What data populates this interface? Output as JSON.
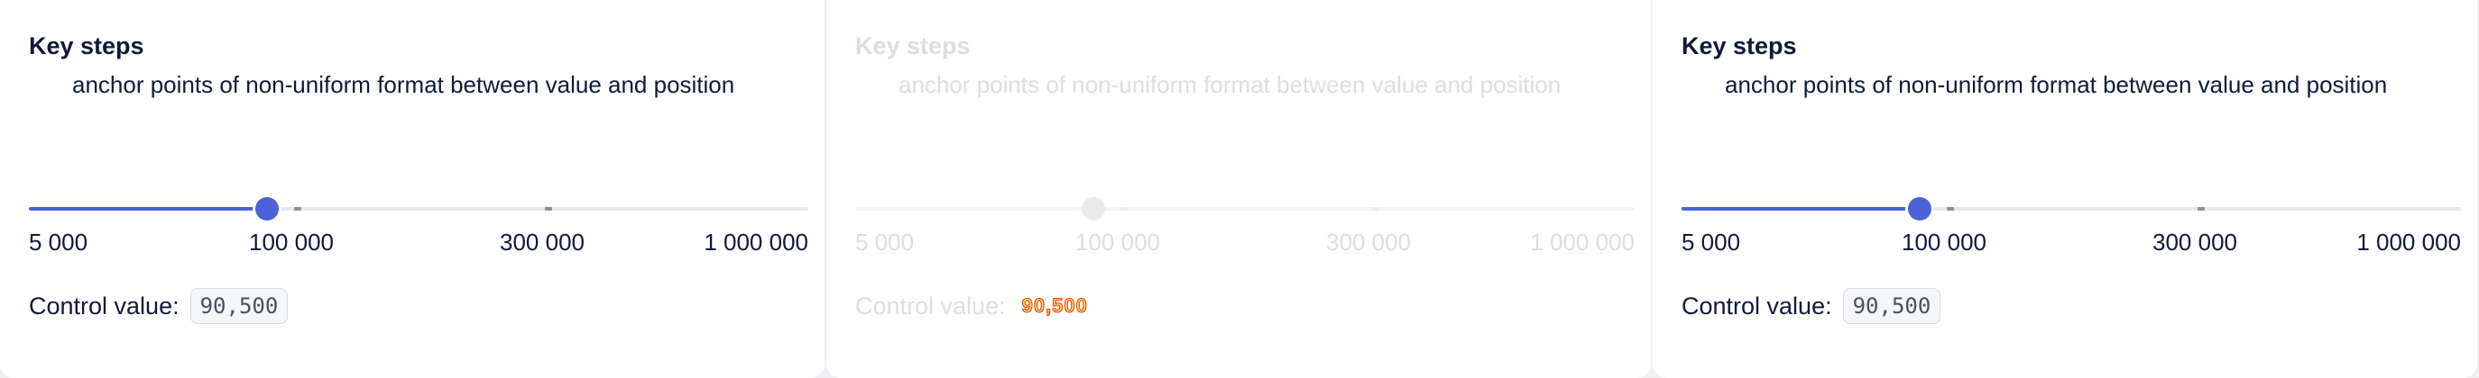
{
  "panels": [
    {
      "title": "Key steps",
      "description": "anchor points of non-uniform format between value and position",
      "slider": {
        "state": "enabled",
        "value_position_fraction": 0.305,
        "marks": [
          "5 000",
          "100 000",
          "300 000",
          "1 000 000"
        ]
      },
      "control_label": "Control value:",
      "control_value": "90,500"
    },
    {
      "title": "Key steps",
      "description": "anchor points of non-uniform format between value and position",
      "slider": {
        "state": "disabled",
        "value_position_fraction": 0.305,
        "marks": [
          "5 000",
          "100 000",
          "300 000",
          "1 000 000"
        ]
      },
      "control_label": "Control value:",
      "control_value": "90,500"
    },
    {
      "title": "Key steps",
      "description": "anchor points of non-uniform format between value and position",
      "slider": {
        "state": "enabled",
        "value_position_fraction": 0.305,
        "marks": [
          "5 000",
          "100 000",
          "300 000",
          "1 000 000"
        ]
      },
      "control_label": "Control value:",
      "control_value": "90,500"
    }
  ],
  "colors": {
    "accent": "#4b63d6",
    "text": "#0f1a3a",
    "rail": "#e7e9ee",
    "background": "#eef0f3"
  }
}
